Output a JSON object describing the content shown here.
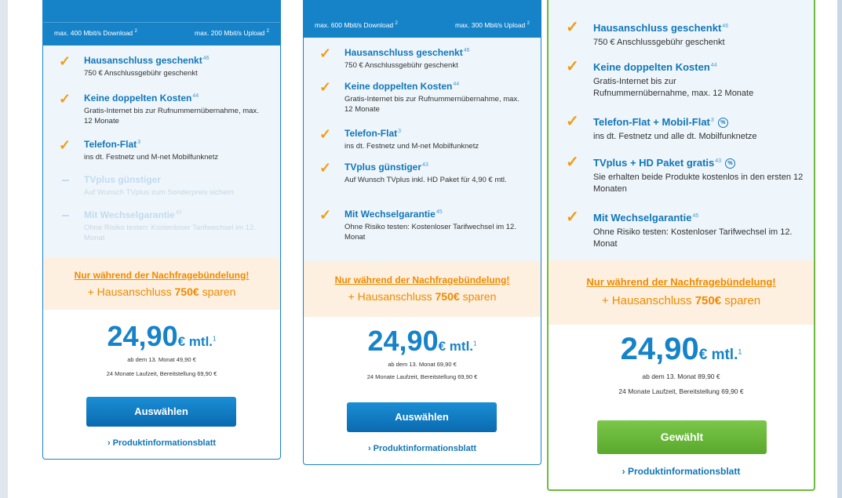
{
  "plans": [
    {
      "download_label": "max. 400 Mbit/s Download",
      "download_sup": "2",
      "upload_label": "max. 200 Mbit/s Upload",
      "upload_sup": "2",
      "features": [
        {
          "title": "Hausanschluss geschenkt",
          "sup": "46",
          "desc": "750 € Anschlussgebühr geschenkt",
          "included": true
        },
        {
          "title": "Keine doppelten Kosten",
          "sup": "44",
          "desc": "Gratis-Internet bis zur Rufnummernübernahme, max. 12 Monate",
          "included": true
        },
        {
          "title": "Telefon-Flat",
          "sup": "3",
          "desc": "ins dt. Festnetz und M-net Mobilfunknetz",
          "included": true
        },
        {
          "title": "TVplus günstiger",
          "sup": "",
          "desc": "Auf Wunsch TVplus zum Sonderpreis sichern",
          "included": false
        },
        {
          "title": "Mit Wechselgarantie",
          "sup": "45",
          "desc": "Ohne Risiko testen: Kostenloser Tarifwechsel im 12. Monat",
          "included": false
        }
      ],
      "promo_title": "Nur während der Nachfragebündelung!",
      "promo_prefix": "+ Hausanschluss",
      "promo_amount": "750€",
      "promo_suffix": "sparen",
      "price": "24,90",
      "price_unit": "€ mtl.",
      "price_sup": "1",
      "after_price": "ab dem 13. Monat 49,90 €",
      "term": "24 Monate Laufzeit, Bereitstellung 69,90 €",
      "button_label": "Auswählen",
      "info_link": "› Produktinformationsblatt"
    },
    {
      "download_label": "max. 600 Mbit/s Download",
      "download_sup": "2",
      "upload_label": "max. 300 Mbit/s Upload",
      "upload_sup": "2",
      "features": [
        {
          "title": "Hausanschluss geschenkt",
          "sup": "46",
          "desc": "750 € Anschlussgebühr geschenkt",
          "included": true
        },
        {
          "title": "Keine doppelten Kosten",
          "sup": "44",
          "desc": "Gratis-Internet bis zur Rufnummernübernahme, max. 12 Monate",
          "included": true
        },
        {
          "title": "Telefon-Flat",
          "sup": "3",
          "desc": "ins dt. Festnetz und M-net Mobilfunknetz",
          "included": true
        },
        {
          "title": "TVplus günstiger",
          "sup": "43",
          "desc": "Auf Wunsch TVplus inkl. HD Paket für 4,90 € mtl.",
          "included": true
        },
        {
          "title": "Mit Wechselgarantie",
          "sup": "45",
          "desc": "Ohne Risiko testen: Kostenloser Tarifwechsel im 12. Monat",
          "included": true
        }
      ],
      "promo_title": "Nur während der Nachfragebündelung!",
      "promo_prefix": "+ Hausanschluss",
      "promo_amount": "750€",
      "promo_suffix": "sparen",
      "price": "24,90",
      "price_unit": "€ mtl.",
      "price_sup": "1",
      "after_price": "ab dem 13. Monat 69,90 €",
      "term": "24 Monate Laufzeit, Bereitstellung 69,90 €",
      "button_label": "Auswählen",
      "info_link": "› Produktinformationsblatt"
    },
    {
      "features": [
        {
          "title": "Hausanschluss geschenkt",
          "sup": "46",
          "desc": "750 € Anschlussgebühr geschenkt",
          "included": true
        },
        {
          "title": "Keine doppelten Kosten",
          "sup": "44",
          "desc": "Gratis-Internet bis zur Rufnummernübernahme, max. 12 Monate",
          "included": true
        },
        {
          "title": "Telefon-Flat + Mobil-Flat",
          "sup": "3",
          "desc": "ins dt. Festnetz und alle dt. Mobilfunknetze",
          "included": true,
          "icon": "percent-icon"
        },
        {
          "title": "TVplus + HD Paket gratis",
          "sup": "43",
          "desc": "Sie erhalten beide Produkte kostenlos in den ersten 12 Monaten",
          "included": true,
          "icon": "percent-icon"
        },
        {
          "title": "Mit Wechselgarantie",
          "sup": "45",
          "desc": "Ohne Risiko testen: Kostenloser Tarifwechsel im 12. Monat",
          "included": true
        }
      ],
      "promo_title": "Nur während der Nachfragebündelung!",
      "promo_prefix": "+ Hausanschluss",
      "promo_amount": "750€",
      "promo_suffix": "sparen",
      "price": "24,90",
      "price_unit": "€ mtl.",
      "price_sup": "1",
      "after_price": "ab dem 13. Monat 89,90 €",
      "term": "24 Monate Laufzeit, Bereitstellung 69,90 €",
      "button_label": "Gewählt",
      "info_link": "› Produktinformationsblatt"
    }
  ],
  "colors": {
    "brand_blue": "#1683c9",
    "accent_orange": "#f08a00",
    "selected_green": "#6cbb3c",
    "feature_bg": "#eef6fc",
    "promo_bg": "#fdf0e0"
  }
}
